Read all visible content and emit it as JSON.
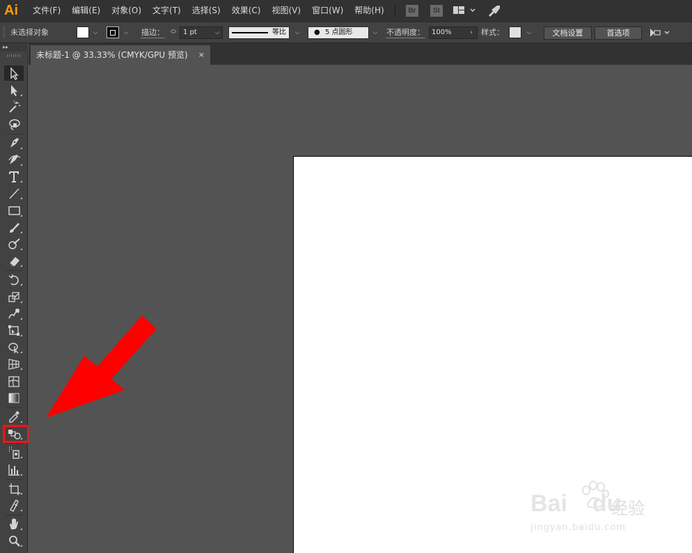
{
  "app": {
    "logo": "Ai"
  },
  "menu": [
    "文件(F)",
    "编辑(E)",
    "对象(O)",
    "文字(T)",
    "选择(S)",
    "效果(C)",
    "视图(V)",
    "窗口(W)",
    "帮助(H)"
  ],
  "menubar_badges": {
    "bridge": "Br",
    "stock": "St"
  },
  "control": {
    "selection_status": "未选择对象",
    "stroke_label": "描边：",
    "stroke_value": "1 pt",
    "profile_label": "等比",
    "brush_label": "5 点圆形",
    "opacity_label": "不透明度：",
    "opacity_value": "100%",
    "style_label": "样式：",
    "doc_setup_label": "文档设置",
    "preferences_label": "首选项"
  },
  "tab": {
    "title": "未标题-1 @ 33.33% (CMYK/GPU 预览)",
    "close": "×"
  },
  "tools": [
    "selection-tool",
    "direct-selection-tool",
    "magic-wand-tool",
    "lasso-tool",
    "pen-tool",
    "curvature-tool",
    "type-tool",
    "line-segment-tool",
    "rectangle-tool",
    "paintbrush-tool",
    "shaper-tool",
    "eraser-tool",
    "rotate-tool",
    "scale-tool",
    "warp-tool",
    "free-transform-tool",
    "shape-builder-tool",
    "perspective-grid-tool",
    "mesh-tool",
    "gradient-tool",
    "eyedropper-tool",
    "blend-tool",
    "symbol-sprayer-tool",
    "column-graph-tool",
    "artboard-tool",
    "slice-tool",
    "hand-tool",
    "zoom-tool"
  ],
  "colors": {
    "annotation": "#ff1111",
    "logo": "#ff9a00"
  },
  "watermark": {
    "brand": "Bai",
    "brand2": "du",
    "cn": "经验",
    "url": "jingyan.baidu.com"
  }
}
